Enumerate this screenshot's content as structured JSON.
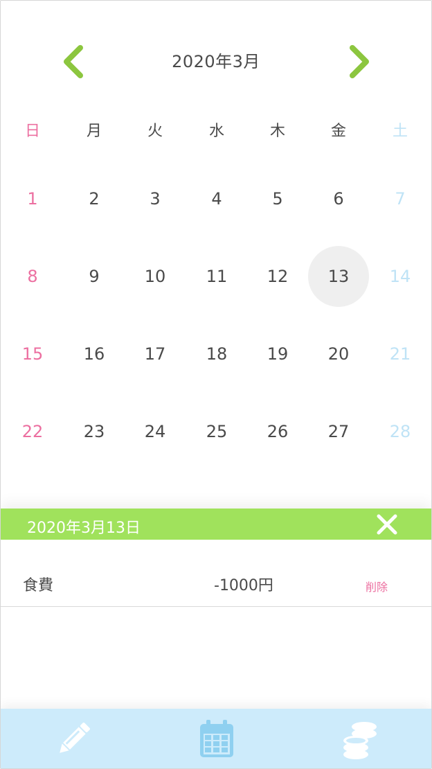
{
  "calendar": {
    "month_label": "2020年3月",
    "weekdays": [
      "日",
      "月",
      "火",
      "水",
      "木",
      "金",
      "土"
    ],
    "weeks": [
      [
        "1",
        "2",
        "3",
        "4",
        "5",
        "6",
        "7"
      ],
      [
        "8",
        "9",
        "10",
        "11",
        "12",
        "13",
        "14"
      ],
      [
        "15",
        "16",
        "17",
        "18",
        "19",
        "20",
        "21"
      ],
      [
        "22",
        "23",
        "24",
        "25",
        "26",
        "27",
        "28"
      ]
    ],
    "selected_day": "13"
  },
  "detail": {
    "date_label": "2020年3月13日",
    "entries": [
      {
        "category": "食費",
        "amount": "-1000円",
        "delete_label": "削除"
      }
    ]
  },
  "tabbar": {
    "items": [
      "pencil-icon",
      "calendar-icon",
      "coins-icon"
    ]
  },
  "colors": {
    "accent_green": "#8cc63f",
    "bar_green": "#a0e25c",
    "sunday": "#ec6fa0",
    "saturday": "#bfe3f6",
    "tabbar_bg": "#cdebfb",
    "tab_icon": "#ffffff",
    "tab_active": "#8fd0f0"
  }
}
